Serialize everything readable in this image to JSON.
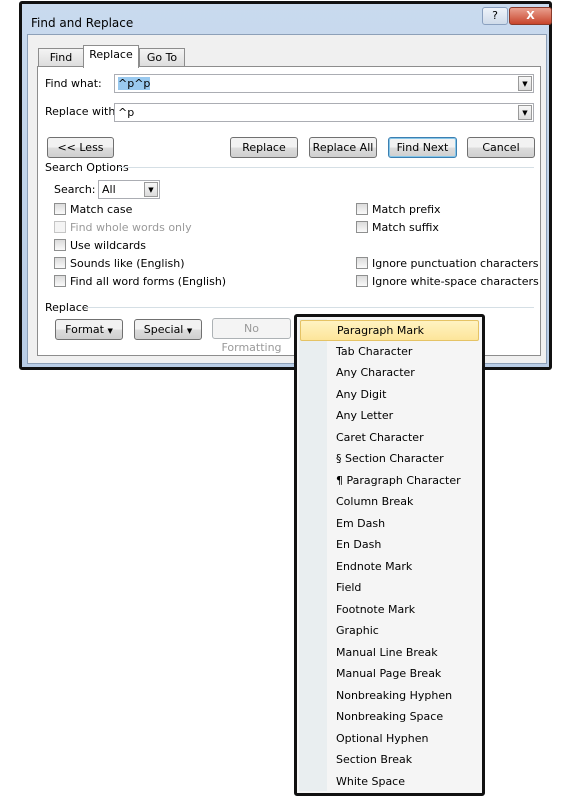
{
  "dialog": {
    "title": "Find and Replace",
    "help_label": "?",
    "close_label": "X",
    "tabs": [
      {
        "label": "Find"
      },
      {
        "label": "Replace",
        "active": true
      },
      {
        "label": "Go To"
      }
    ],
    "find_what": {
      "label": "Find what:",
      "value": "^p^p"
    },
    "replace_with": {
      "label": "Replace with:",
      "value": "^p"
    },
    "buttons": {
      "less": "<< Less",
      "replace": "Replace",
      "replace_all": "Replace All",
      "find_next": "Find Next",
      "cancel": "Cancel"
    },
    "search_options": {
      "label": "Search Options",
      "search_label": "Search:",
      "search_value": "All",
      "left": [
        {
          "label": "Match case",
          "checked": false,
          "enabled": true
        },
        {
          "label": "Find whole words only",
          "checked": false,
          "enabled": false
        },
        {
          "label": "Use wildcards",
          "checked": false,
          "enabled": true
        },
        {
          "label": "Sounds like (English)",
          "checked": false,
          "enabled": true
        },
        {
          "label": "Find all word forms (English)",
          "checked": false,
          "enabled": true
        }
      ],
      "right": [
        {
          "label": "Match prefix",
          "checked": false
        },
        {
          "label": "Match suffix",
          "checked": false
        },
        {
          "label": "Ignore punctuation characters",
          "checked": false
        },
        {
          "label": "Ignore white-space characters",
          "checked": false
        }
      ]
    },
    "replace_group": {
      "label": "Replace",
      "format": "Format",
      "special": "Special",
      "no_formatting": "No Formatting"
    }
  },
  "special_menu": {
    "highlighted": "Paragraph Mark",
    "highlight_color": "#fde59a",
    "items": [
      "Paragraph Mark",
      "Tab Character",
      "Any Character",
      "Any Digit",
      "Any Letter",
      "Caret Character",
      "§ Section Character",
      "¶ Paragraph Character",
      "Column Break",
      "Em Dash",
      "En Dash",
      "Endnote Mark",
      "Field",
      "Footnote Mark",
      "Graphic",
      "Manual Line Break",
      "Manual Page Break",
      "Nonbreaking Hyphen",
      "Nonbreaking Space",
      "Optional Hyphen",
      "Section Break",
      "White Space"
    ]
  }
}
